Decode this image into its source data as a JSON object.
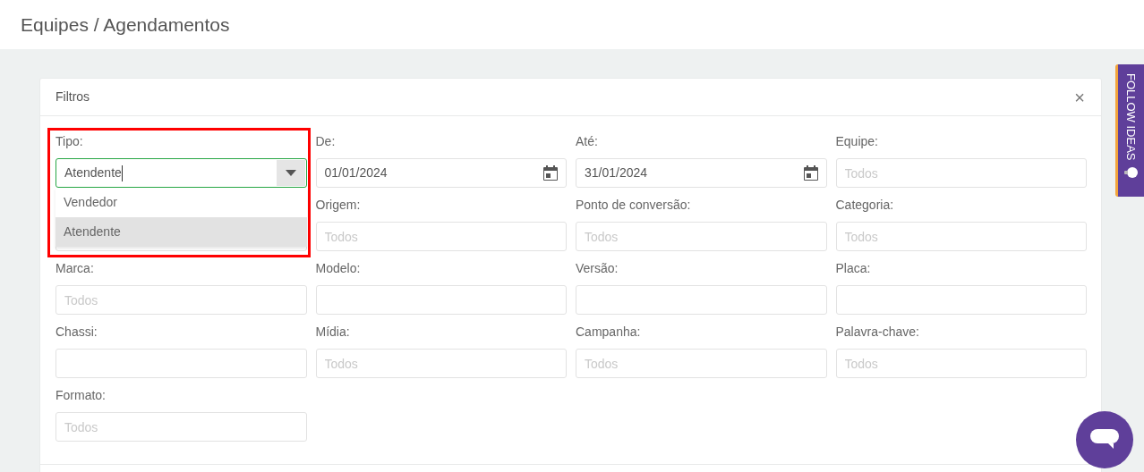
{
  "page_title": "Equipes / Agendamentos",
  "filters": {
    "title": "Filtros",
    "close": "×",
    "fields": [
      {
        "kind": "select",
        "label": "Tipo:",
        "value": "Atendente",
        "open": true,
        "options": [
          {
            "label": "Vendedor",
            "selected": false
          },
          {
            "label": "Atendente",
            "selected": true
          }
        ]
      },
      {
        "kind": "date",
        "label": "De:",
        "value": "01/01/2024"
      },
      {
        "kind": "date",
        "label": "Até:",
        "value": "31/01/2024"
      },
      {
        "kind": "text",
        "label": "Equipe:",
        "placeholder": "Todos"
      },
      {
        "kind": "hidden"
      },
      {
        "kind": "text",
        "label": "Origem:",
        "placeholder": "Todos"
      },
      {
        "kind": "text",
        "label": "Ponto de conversão:",
        "placeholder": "Todos"
      },
      {
        "kind": "text",
        "label": "Categoria:",
        "placeholder": "Todos"
      },
      {
        "kind": "text",
        "label": "Marca:",
        "placeholder": "Todos"
      },
      {
        "kind": "text",
        "label": "Modelo:"
      },
      {
        "kind": "text",
        "label": "Versão:"
      },
      {
        "kind": "text",
        "label": "Placa:"
      },
      {
        "kind": "text",
        "label": "Chassi:"
      },
      {
        "kind": "text",
        "label": "Mídia:",
        "placeholder": "Todos"
      },
      {
        "kind": "text",
        "label": "Campanha:",
        "placeholder": "Todos"
      },
      {
        "kind": "text",
        "label": "Palavra-chave:",
        "placeholder": "Todos"
      },
      {
        "kind": "text",
        "label": "Formato:",
        "placeholder": "Todos"
      }
    ]
  },
  "side_tab": {
    "label": "FOLLOW IDEAS"
  }
}
